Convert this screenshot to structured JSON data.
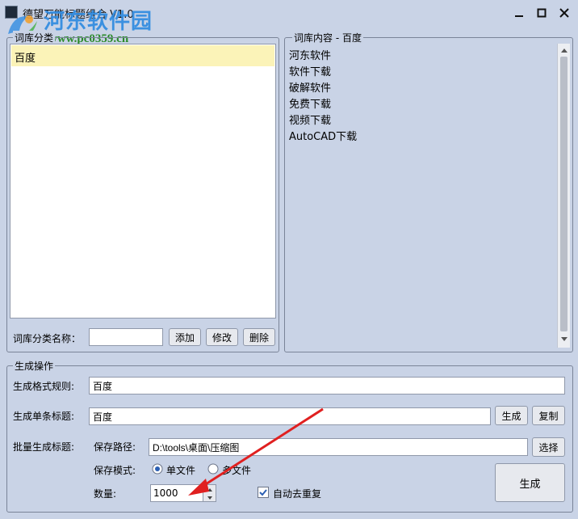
{
  "window": {
    "title": "德望万能标题组合 V1.0",
    "controls": {
      "minimize": "—",
      "maximize": "☐",
      "close": "✕"
    }
  },
  "watermark": {
    "title": "河东软件园",
    "url": "www.pc0359.cn"
  },
  "category_panel": {
    "group_label": "词库分类",
    "items": [
      "百度"
    ],
    "name_label": "词库分类名称：",
    "name_value": "",
    "add_label": "添加",
    "edit_label": "修改",
    "delete_label": "删除"
  },
  "content_panel": {
    "group_label": "词库内容 - 百度",
    "items": [
      "河东软件",
      "软件下载",
      "破解软件",
      "免费下载",
      "视频下载",
      "AutoCAD下载"
    ]
  },
  "generate": {
    "group_label": "生成操作",
    "format_label": "生成格式规则:",
    "format_value": "百度",
    "single_label": "生成单条标题:",
    "single_value": "百度",
    "single_generate": "生成",
    "copy_label": "复制",
    "batch_label": "批量生成标题:",
    "save_path_label": "保存路径:",
    "save_path_value": "D:\\tools\\桌面\\压缩图",
    "select_label": "选择",
    "save_mode_label": "保存模式:",
    "mode_single": "单文件",
    "mode_multi": "多文件",
    "quantity_label": "数量:",
    "quantity_value": "1000",
    "dedup_label": "自动去重复",
    "batch_generate": "生成"
  }
}
